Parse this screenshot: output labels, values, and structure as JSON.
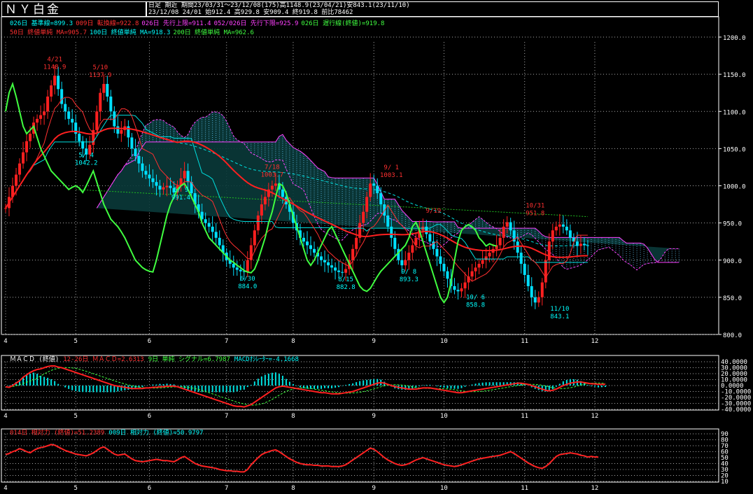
{
  "header": {
    "title": "ＮＹ白金",
    "line1_a": "日足",
    "line1_b": "期近",
    "line1_c": "期間23/03/31～23/12/08(175)高1148.9(23/04/21)安843.1(23/11/10)",
    "line2": "23/12/08 24/01 始912.4 高929.8 安909.4 終919.8 前比78462"
  },
  "legend": {
    "ichimoku": [
      {
        "text": "026日 基準線=899.3",
        "color": "#00ffff"
      },
      {
        "text": "009日 転換線=922.8",
        "color": "#ff3030"
      },
      {
        "text": "026日 先行上限=911.4",
        "color": "#ff40ff"
      },
      {
        "text": "052/026日 先行下限=925.9",
        "color": "#ff40ff"
      },
      {
        "text": "026日 遅行線(終値)=919.8",
        "color": "#40ff40"
      }
    ],
    "ma": [
      {
        "text": "50日 終値単純 MA=905.7",
        "color": "#ff3030"
      },
      {
        "text": "100日 終値単純 MA=918.3",
        "color": "#00ffff"
      },
      {
        "text": "200日 終値単純 MA=962.6",
        "color": "#40ff40"
      }
    ],
    "macd": [
      {
        "text": "ＭＡＣＤ (終値)",
        "color": "#ffffff"
      },
      {
        "text": "12-26日 ＭＡＣＤ=2.6313",
        "color": "#ff3030"
      },
      {
        "text": "9日 単純 シグナル=6.7987",
        "color": "#40ff40"
      },
      {
        "text": "MACDｵｼﾚｰﾀｰ=-4.1668",
        "color": "#00ffff"
      }
    ],
    "rsi": [
      {
        "text": "014日 相対力 (終値)=51.2389",
        "color": "#ff3030"
      },
      {
        "text": "009日 相対力 (終値)=50.9797",
        "color": "#00ffff"
      }
    ]
  },
  "month_labels": [
    "4",
    "5",
    "6",
    "7",
    "8",
    "9",
    "10",
    "11",
    "12"
  ],
  "price_axis": [
    "1200.0",
    "1150.0",
    "1100.0",
    "1050.0",
    "1000.0",
    "950.0",
    "900.0",
    "850.0",
    "800.0"
  ],
  "macd_axis": [
    "40.0000",
    "30.0000",
    "20.0000",
    "10.0000",
    "0.0000",
    "-10.0000",
    "-20.0000",
    "-30.0000",
    "-40.0000"
  ],
  "rsi_axis": [
    "90",
    "80",
    "70",
    "60",
    "50",
    "40",
    "30",
    "20",
    "10"
  ],
  "annotations": [
    {
      "date": "4/21",
      "value": "1148.9",
      "color": "#ff3030",
      "day": 14,
      "price": 1148.9,
      "pos": "above"
    },
    {
      "date": "5/10",
      "value": "1137.9",
      "color": "#ff3030",
      "day": 27,
      "price": 1137.9,
      "pos": "above"
    },
    {
      "date": "5/ 4",
      "value": "1042.2",
      "color": "#00ffff",
      "day": 23,
      "price": 1020,
      "pos": "above"
    },
    {
      "date": "6/ 9",
      "value": "991.4",
      "color": "#00ffff",
      "day": 48,
      "price": 990,
      "pos": "right"
    },
    {
      "date": "7/18",
      "value": "1003.7",
      "color": "#ff3030",
      "day": 76,
      "price": 1003.7,
      "pos": "above"
    },
    {
      "date": "6/30",
      "value": "884.0",
      "color": "#00ffff",
      "day": 69,
      "price": 884.0,
      "pos": "below"
    },
    {
      "date": "8/15",
      "value": "882.8",
      "color": "#00ffff",
      "day": 97,
      "price": 882.8,
      "pos": "below"
    },
    {
      "date": "9/ 1",
      "value": "1003.1",
      "color": "#ff3030",
      "day": 110,
      "price": 1003.1,
      "pos": "above"
    },
    {
      "date": "9/19",
      "value": "",
      "color": "#ff3030",
      "day": 122,
      "price": 945,
      "pos": "above"
    },
    {
      "date": "9/ 8",
      "value": "893.3",
      "color": "#00ffff",
      "day": 115,
      "price": 893.3,
      "pos": "below"
    },
    {
      "date": "10/ 6",
      "value": "858.8",
      "color": "#00ffff",
      "day": 134,
      "price": 858.8,
      "pos": "below"
    },
    {
      "date": "10/31",
      "value": "951.8",
      "color": "#ff3030",
      "day": 151,
      "price": 951.8,
      "pos": "above"
    },
    {
      "date": "11/10",
      "value": "843.1",
      "color": "#00ffff",
      "day": 158,
      "price": 843.1,
      "pos": "below"
    }
  ],
  "chart_data": {
    "type": "candlestick",
    "title": "ＮＹ白金",
    "period": "23/03/31～23/12/08",
    "ylim": [
      800,
      1200
    ],
    "trading_days": 175,
    "month_start_day": [
      0,
      20,
      41,
      63,
      82,
      105,
      125,
      148,
      168
    ],
    "closes": [
      970,
      985,
      1000,
      1015,
      1030,
      1045,
      1060,
      1070,
      1085,
      1090,
      1095,
      1100,
      1120,
      1135,
      1148,
      1130,
      1110,
      1100,
      1090,
      1085,
      1070,
      1060,
      1050,
      1042,
      1055,
      1075,
      1100,
      1125,
      1137,
      1120,
      1100,
      1080,
      1070,
      1075,
      1080,
      1065,
      1050,
      1040,
      1030,
      1020,
      1015,
      1010,
      1005,
      1000,
      995,
      998,
      1000,
      997,
      991,
      1000,
      1010,
      1020,
      1005,
      990,
      975,
      965,
      955,
      950,
      945,
      938,
      930,
      920,
      910,
      900,
      895,
      890,
      887,
      885,
      884,
      900,
      920,
      940,
      960,
      975,
      985,
      995,
      1000,
      1003,
      995,
      985,
      975,
      965,
      950,
      940,
      930,
      925,
      920,
      915,
      910,
      905,
      900,
      897,
      893,
      890,
      886,
      884,
      883,
      888,
      900,
      915,
      930,
      950,
      965,
      985,
      1003,
      1000,
      990,
      975,
      960,
      945,
      930,
      915,
      900,
      893,
      900,
      910,
      920,
      930,
      940,
      945,
      935,
      925,
      915,
      905,
      895,
      885,
      875,
      865,
      860,
      858,
      862,
      870,
      878,
      885,
      890,
      895,
      900,
      905,
      910,
      915,
      920,
      930,
      945,
      951,
      940,
      925,
      910,
      895,
      880,
      865,
      850,
      843,
      850,
      870,
      900,
      925,
      940,
      945,
      948,
      945,
      940,
      930,
      925,
      919,
      922,
      920,
      919
    ]
  },
  "macd_data": {
    "ylim": [
      -40,
      40
    ],
    "macd": [
      -2,
      -3,
      0,
      4,
      8,
      14,
      18,
      22,
      25,
      27,
      28,
      30,
      32,
      33,
      33,
      31,
      30,
      28,
      26,
      24,
      22,
      20,
      18,
      16,
      14,
      12,
      10,
      8,
      6,
      4,
      2,
      0,
      -1,
      -2,
      -3,
      -4,
      -5,
      -5,
      -5,
      -5,
      -4,
      -4,
      -3,
      -3,
      -2,
      -2,
      -1,
      -1,
      -1,
      -2,
      -4,
      -6,
      -8,
      -10,
      -12,
      -14,
      -16,
      -18,
      -20,
      -22,
      -24,
      -26,
      -28,
      -30,
      -32,
      -34,
      -35,
      -35,
      -36,
      -34,
      -32,
      -28,
      -24,
      -20,
      -16,
      -12,
      -8,
      -4,
      -2,
      -1,
      -2,
      -3,
      -4,
      -5,
      -6,
      -7,
      -8,
      -9,
      -10,
      -11,
      -12,
      -12,
      -13,
      -14,
      -14,
      -14,
      -13,
      -12,
      -11,
      -10,
      -8,
      -6,
      -4,
      -2,
      0,
      2,
      4,
      5,
      4,
      2,
      0,
      -2,
      -3,
      -4,
      -5,
      -6,
      -6,
      -6,
      -5,
      -4,
      -4,
      -4,
      -5,
      -6,
      -7,
      -8,
      -9,
      -10,
      -11,
      -12,
      -12,
      -11,
      -10,
      -9,
      -8,
      -7,
      -6,
      -5,
      -4,
      -3,
      -2,
      -1,
      0,
      1,
      2,
      3,
      4,
      4,
      3,
      2,
      0,
      -2,
      -4,
      -6,
      -8,
      -9,
      -8,
      -6,
      -3,
      0,
      2,
      4,
      5,
      6,
      6,
      5,
      4,
      3,
      3,
      2,
      2,
      2
    ]
  },
  "rsi_data": {
    "ylim": [
      10,
      90
    ],
    "rsi14": [
      55,
      57,
      60,
      62,
      65,
      63,
      60,
      58,
      62,
      65,
      67,
      68,
      70,
      72,
      71,
      68,
      65,
      62,
      60,
      58,
      56,
      55,
      54,
      53,
      55,
      58,
      62,
      66,
      68,
      64,
      60,
      56,
      54,
      55,
      56,
      52,
      48,
      45,
      44,
      43,
      44,
      45,
      46,
      47,
      46,
      45,
      45,
      44,
      43,
      46,
      50,
      52,
      48,
      44,
      40,
      38,
      36,
      35,
      34,
      33,
      32,
      30,
      29,
      28,
      28,
      27,
      27,
      26,
      26,
      30,
      38,
      44,
      50,
      55,
      58,
      60,
      62,
      63,
      60,
      56,
      52,
      48,
      45,
      42,
      40,
      39,
      38,
      38,
      37,
      37,
      36,
      36,
      36,
      35,
      35,
      35,
      36,
      38,
      42,
      46,
      50,
      54,
      58,
      62,
      66,
      64,
      60,
      55,
      50,
      46,
      43,
      40,
      38,
      37,
      38,
      40,
      43,
      46,
      48,
      50,
      48,
      46,
      44,
      42,
      40,
      38,
      37,
      36,
      35,
      36,
      38,
      40,
      42,
      44,
      46,
      48,
      49,
      50,
      51,
      52,
      53,
      54,
      56,
      58,
      60,
      57,
      53,
      49,
      45,
      41,
      38,
      35,
      33,
      32,
      35,
      40,
      46,
      52,
      55,
      56,
      57,
      58,
      57,
      56,
      54,
      53,
      51,
      52,
      51,
      51
    ]
  }
}
